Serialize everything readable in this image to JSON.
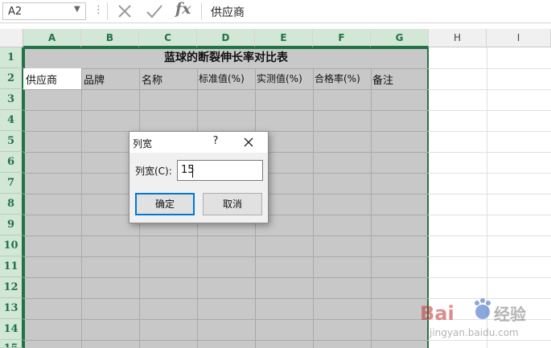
{
  "formula_bar": {
    "name_box": "A2",
    "fx_label": "fx",
    "value": "供应商"
  },
  "grid": {
    "columns": [
      "A",
      "B",
      "C",
      "D",
      "E",
      "F",
      "G",
      "H",
      "I"
    ],
    "rows": [
      "1",
      "2",
      "3",
      "4",
      "5",
      "6",
      "7",
      "8",
      "9",
      "10",
      "11",
      "12",
      "13",
      "14",
      "15"
    ],
    "title": "蓝球的断裂伸长率对比表",
    "headers": [
      "供应商",
      "品牌",
      "名称",
      "标准值(%)",
      "实测值(%)",
      "合格率(%)",
      "备注"
    ]
  },
  "dialog": {
    "title": "列宽",
    "help": "?",
    "label": "列宽(C):",
    "value": "15",
    "ok_label": "确定",
    "cancel_label": "取消"
  },
  "colors": {
    "accent": "#217346",
    "selection_fill": "#c8c8c8",
    "header_selected": "#d3e7d7"
  },
  "watermark": {
    "brand": "Bai",
    "brand_cn": "经验",
    "url": "jingyan.baidu.com"
  }
}
